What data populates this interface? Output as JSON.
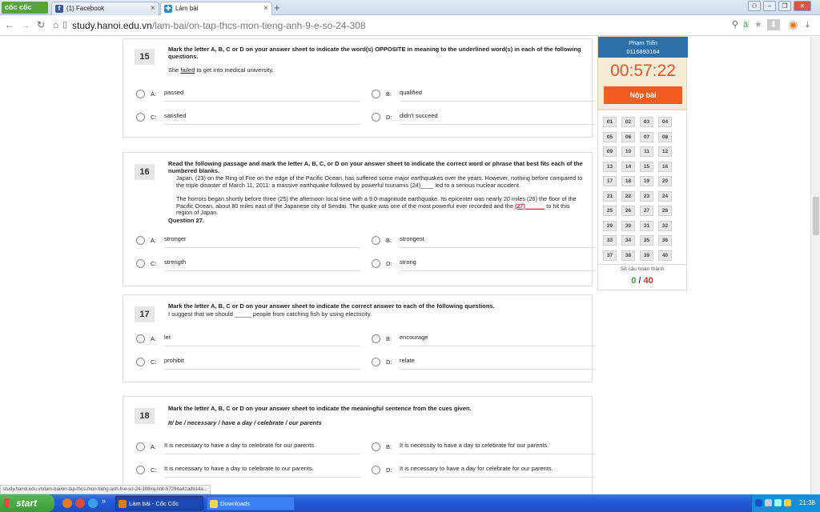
{
  "browser": {
    "brand": "cốc cốc",
    "tabs": [
      {
        "label": "(1) Facebook"
      },
      {
        "label": "Làm bài"
      }
    ],
    "new_tab": "+",
    "url_domain": "study.hanoi.edu.vn",
    "url_path": "/lam-bai/on-tap-thcs-mon-tieng-anh-9-e-so-24-308"
  },
  "questions": [
    {
      "number": "15",
      "instruction": "Mark the letter A, B, C or D on your answer sheet to indicate the word(s) OPPOSITE in meaning to the underlined word(s) in each of the following questions.",
      "sentence_before": "She ",
      "sentence_underlined": "failed",
      "sentence_after": " to get into medical university.",
      "options": [
        {
          "letter": "A:",
          "text": "passed"
        },
        {
          "letter": "B:",
          "text": "qualified"
        },
        {
          "letter": "C:",
          "text": "satisfied"
        },
        {
          "letter": "D:",
          "text": "didn't succeed"
        }
      ]
    },
    {
      "number": "16",
      "instruction": "Read the following passage and mark the letter A, B, C, or D on your answer sheet to indicate the correct word or phrase that best fits each of the numbered blanks.",
      "passage_1": "Japan, (23)        on the Ring of Fire on the edge of the Pacific Ocean, has suffered some major earthquakes over the years. However, nothing before compared to the triple disaster of March 11, 2011: a massive earthquake followed by powerful tsunamis (24)____ led to a serious nuclear accident.",
      "passage_2a": "The horrors began shortly before three (25)      the afternoon local time with a 9.0-magnitude earthquake. Its epicenter was nearly 20 miles (26)     the floor of the Pacific Ocean, about 80 miles east of the Japanese city of Sendai. The quake was one of the most powerful ever recorded and the ",
      "passage_blank": "(27)______",
      "passage_2b": " to hit this region of Japan.",
      "subquestion": "Question 27.",
      "options": [
        {
          "letter": "A:",
          "text": "stronger"
        },
        {
          "letter": "B:",
          "text": "strongest"
        },
        {
          "letter": "C:",
          "text": "strength"
        },
        {
          "letter": "D:",
          "text": "strong"
        }
      ]
    },
    {
      "number": "17",
      "instruction": "Mark the letter A, B, C or D on your answer sheet to indicate the correct answer to each of the following questions.",
      "sentence": "I suggest that we should _____ people from catching fish by using electricity.",
      "options": [
        {
          "letter": "A:",
          "text": "let"
        },
        {
          "letter": "B:",
          "text": "encourage"
        },
        {
          "letter": "C:",
          "text": "prohibit"
        },
        {
          "letter": "D:",
          "text": "relate"
        }
      ]
    },
    {
      "number": "18",
      "instruction": "Mark the letter A, B, C or D on your answer sheet to indicate the meaningful sentence from the cues given.",
      "cue": "It/ be / necessary / have a day / celebrate / our parents",
      "options": [
        {
          "letter": "A:",
          "text": "It is necessary to have a day to celebrate for our parents."
        },
        {
          "letter": "B:",
          "text": "It is necessity to have a day to celebrate for our parents."
        },
        {
          "letter": "C:",
          "text": "It is necessary to have a day to celebrate to our parents."
        },
        {
          "letter": "D:",
          "text": "It is necessary to have a day for celebrate for our parents."
        }
      ]
    }
  ],
  "sidebar": {
    "student_name": "Phạm Tiến",
    "student_id": "0116893164",
    "timer": "00:57:22",
    "submit_label": "Nộp bài",
    "question_grid": [
      "01",
      "02",
      "03",
      "04",
      "05",
      "06",
      "07",
      "08",
      "09",
      "10",
      "11",
      "12",
      "13",
      "14",
      "15",
      "16",
      "17",
      "18",
      "19",
      "20",
      "21",
      "22",
      "23",
      "24",
      "25",
      "26",
      "27",
      "28",
      "29",
      "30",
      "31",
      "32",
      "33",
      "34",
      "35",
      "36",
      "37",
      "38",
      "39",
      "40"
    ],
    "completed_label": "Số câu hoàn thành",
    "completed_count": "0",
    "separator": "/",
    "total_count": "40"
  },
  "status_url": "study.hanoi.edu.vn/lam-bai/on-tap-thcs-mon-tieng-anh-9-e-so-24-308#q-link-57294a41adb14a...",
  "taskbar": {
    "start_label": "start",
    "tasks": [
      {
        "label": "Làm bài - Cốc Cốc"
      },
      {
        "label": "Downloads"
      }
    ],
    "quick_more": "»",
    "clock": "21:38"
  },
  "colors": {
    "timer": "#e0522e",
    "submit": "#f35c21",
    "profile_header": "#2d6fa8",
    "completed_count": "#3a9a3a",
    "total_count": "#d03030",
    "brand": "#56a43a"
  }
}
